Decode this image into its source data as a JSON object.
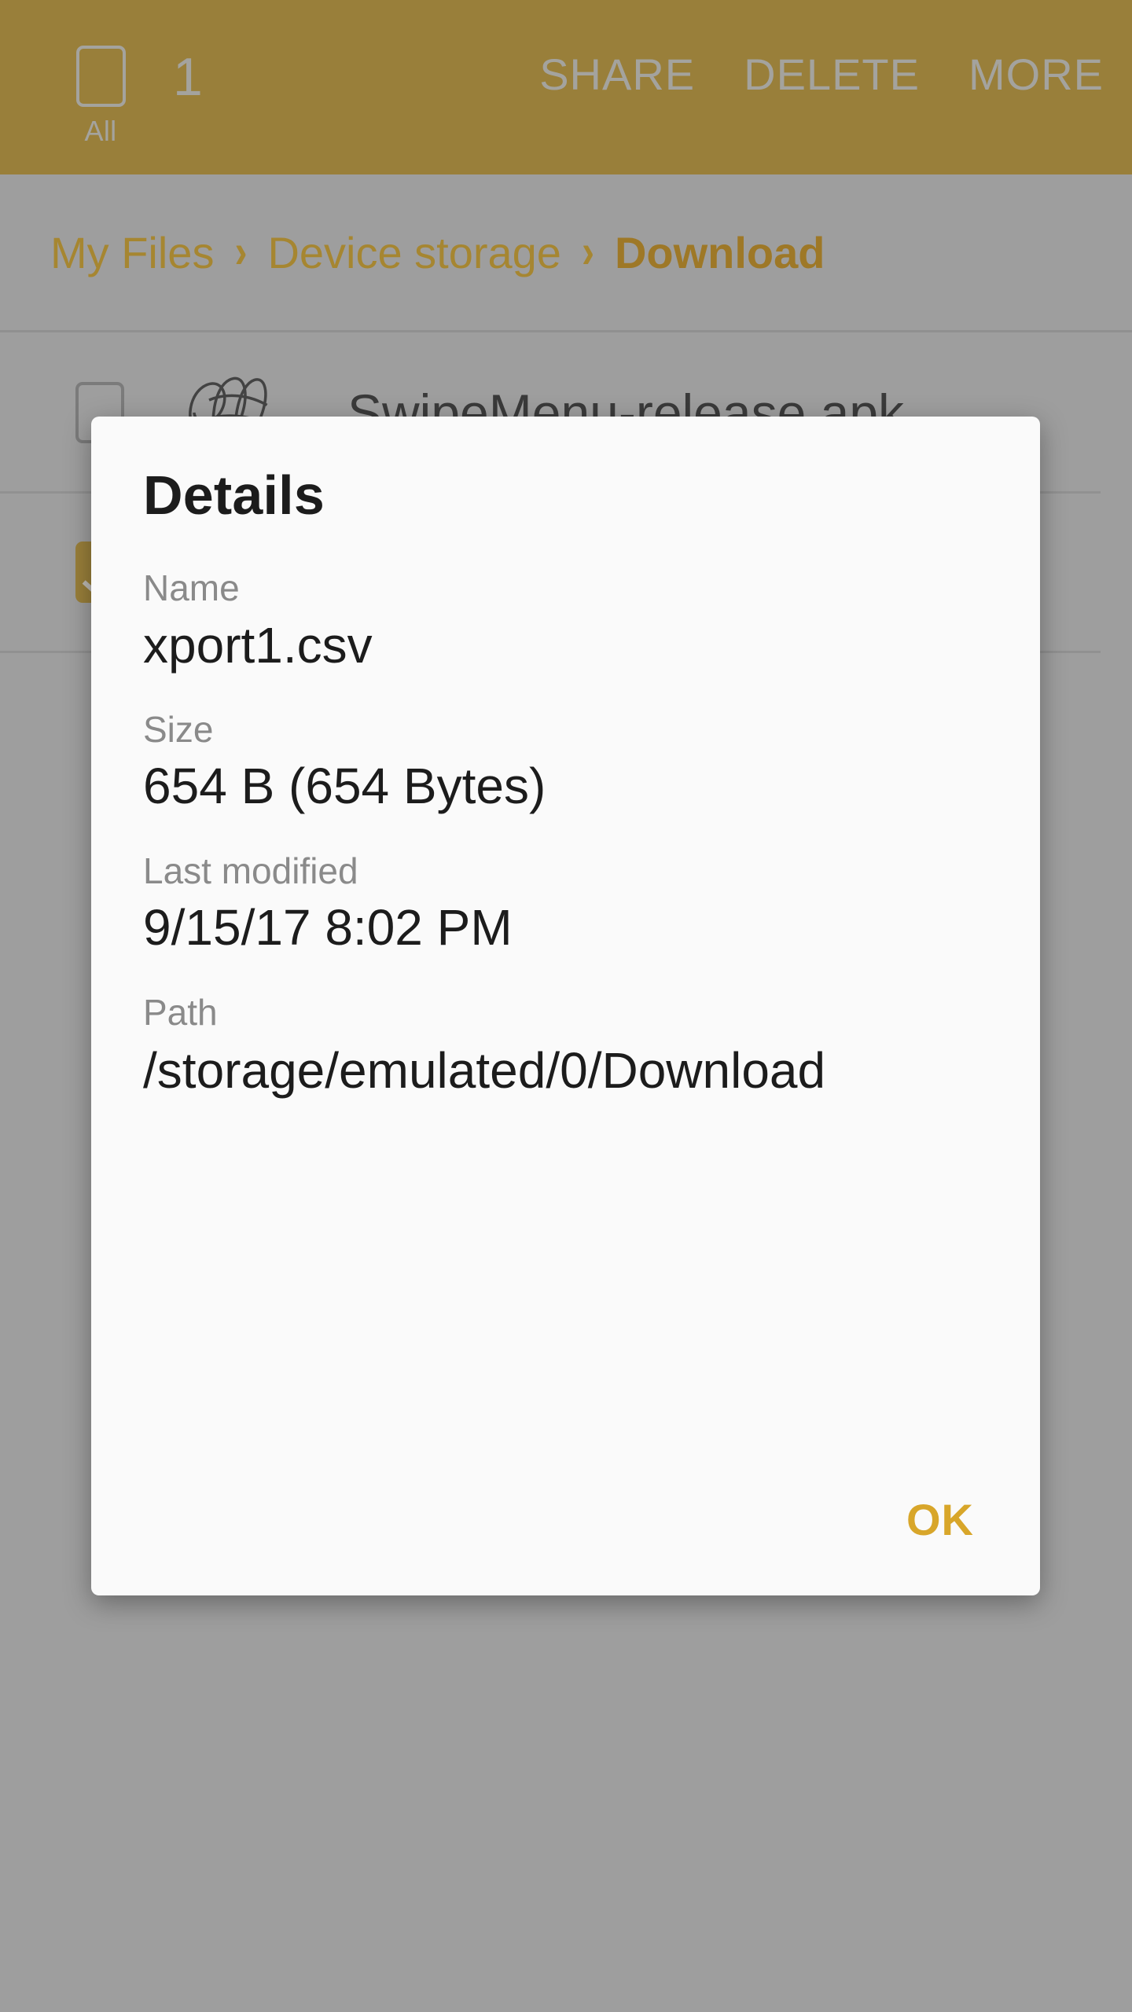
{
  "action_bar": {
    "select_all_checkbox_label": "All",
    "selected_count": "1",
    "buttons": [
      {
        "label": "SHARE",
        "name": "share-button"
      },
      {
        "label": "DELETE",
        "name": "delete-button"
      },
      {
        "label": "MORE",
        "name": "more-button"
      }
    ],
    "background_color": "#a8821c",
    "text_color": "#b9b7b0"
  },
  "breadcrumb": {
    "separator": "›",
    "items": [
      {
        "label": "My Files",
        "current": false
      },
      {
        "label": "Device storage",
        "current": false
      },
      {
        "label": "Download",
        "current": true
      }
    ],
    "link_color": "#bc8c10",
    "current_color": "#b07800"
  },
  "file_list": {
    "rows": [
      {
        "name": "SwipeMenu-release.apk",
        "checked": false,
        "icon": "apk-scribble-icon"
      },
      {
        "name": "",
        "checked": true,
        "icon": "file-icon"
      }
    ]
  },
  "dialog": {
    "title": "Details",
    "fields": [
      {
        "label": "Name",
        "value": "xport1.csv"
      },
      {
        "label": "Size",
        "value": "654 B (654 Bytes)"
      },
      {
        "label": "Last modified",
        "value": "9/15/17 8:02 PM"
      },
      {
        "label": "Path",
        "value": "/storage/emulated/0/Download"
      }
    ],
    "ok_label": "OK",
    "ok_color": "#d8a62a",
    "background_color": "#fafafa"
  },
  "colors": {
    "scrim": "#b0b0b0",
    "accent": "#a8821c"
  }
}
